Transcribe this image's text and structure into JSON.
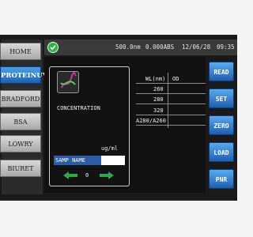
{
  "sidebar": {
    "items": [
      {
        "label": "HOME",
        "active": false
      },
      {
        "label": "PROTEINUV",
        "active": true
      },
      {
        "label": "BRADFORD",
        "active": false
      },
      {
        "label": "BSA",
        "active": false
      },
      {
        "label": "LOWRY",
        "active": false
      },
      {
        "label": "BIURET",
        "active": false
      }
    ]
  },
  "status_bar": {
    "icon": "check-icon",
    "wavelength": "500.0nm",
    "absorbance": "0.000ABS",
    "date": "12/06/28",
    "time": "09:35"
  },
  "panel": {
    "icon": "dna-icon",
    "mode_label": "CONCENTRATION",
    "unit": "ug/ml",
    "sample_label": "SAMP NAME",
    "sample_value": "",
    "counter": "0"
  },
  "table": {
    "headers": [
      "WL(nm)",
      "OD"
    ],
    "rows": [
      {
        "wl": "260",
        "od": ""
      },
      {
        "wl": "280",
        "od": ""
      },
      {
        "wl": "320",
        "od": ""
      },
      {
        "wl": "A280/A260",
        "od": ""
      }
    ]
  },
  "right_buttons": {
    "read": "READ",
    "set": "SET",
    "zero": "ZERO",
    "load": "LOAD",
    "print": "PNR"
  },
  "colors": {
    "active_blue": "#1d5fb0",
    "status_green": "#2fb04a",
    "arrow_green": "#2fa84a"
  }
}
